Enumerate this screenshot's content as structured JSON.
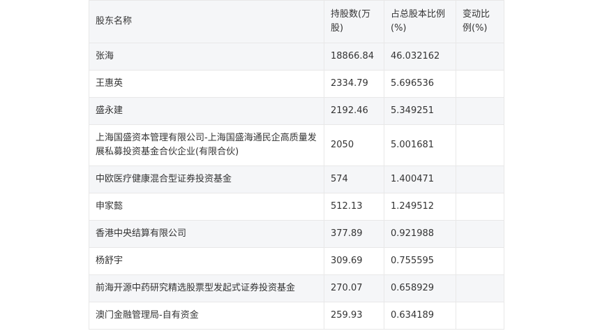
{
  "table": {
    "headers": [
      "股东名称",
      "持股数(万股)",
      "占总股本比例(%)",
      "变动比例(%)"
    ],
    "rows": [
      [
        "张海",
        "18866.84",
        "46.032162",
        ""
      ],
      [
        "王惠英",
        "2334.79",
        "5.696536",
        ""
      ],
      [
        "盛永建",
        "2192.46",
        "5.349251",
        ""
      ],
      [
        "上海国盛资本管理有限公司-上海国盛海通民企高质量发展私募投资基金合伙企业(有限合伙)",
        "2050",
        "5.001681",
        ""
      ],
      [
        "中欧医疗健康混合型证券投资基金",
        "574",
        "1.400471",
        ""
      ],
      [
        "申家懿",
        "512.13",
        "1.249512",
        ""
      ],
      [
        "香港中央结算有限公司",
        "377.89",
        "0.921988",
        ""
      ],
      [
        "杨舒宇",
        "309.69",
        "0.755595",
        ""
      ],
      [
        "前海开源中药研究精选股票型发起式证券投资基金",
        "270.07",
        "0.658929",
        ""
      ],
      [
        "澳门金融管理局-自有资金",
        "259.93",
        "0.634189",
        ""
      ]
    ]
  }
}
